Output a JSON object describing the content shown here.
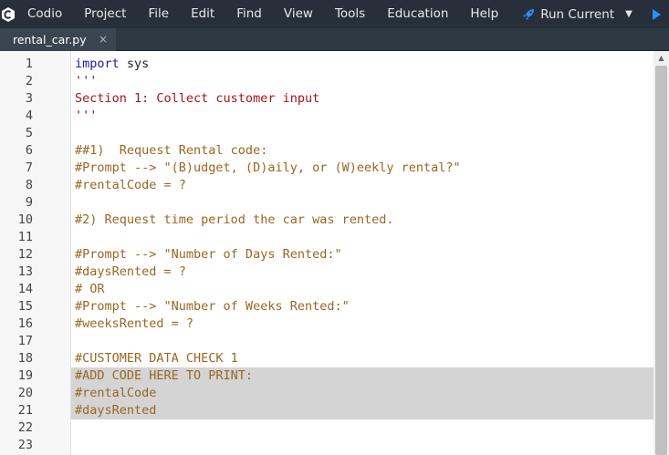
{
  "menubar": {
    "items": [
      "Codio",
      "Project",
      "File",
      "Edit",
      "Find",
      "View",
      "Tools",
      "Education",
      "Help"
    ],
    "run_label": "Run Current",
    "go_label": "Go"
  },
  "tab": {
    "filename": "rental_car.py",
    "close": "×"
  },
  "editor": {
    "lines": [
      {
        "n": "1",
        "parts": [
          {
            "t": "import",
            "c": "kw"
          },
          {
            "t": " sys",
            "c": "plain"
          }
        ]
      },
      {
        "n": "2",
        "parts": [
          {
            "t": "'''",
            "c": "str"
          }
        ]
      },
      {
        "n": "3",
        "parts": [
          {
            "t": "Section 1: Collect customer input",
            "c": "str"
          }
        ]
      },
      {
        "n": "4",
        "parts": [
          {
            "t": "'''",
            "c": "str"
          }
        ]
      },
      {
        "n": "5",
        "parts": []
      },
      {
        "n": "6",
        "parts": [
          {
            "t": "##1)  Request Rental code:",
            "c": "cm"
          }
        ]
      },
      {
        "n": "7",
        "parts": [
          {
            "t": "#Prompt --> \"(B)udget, (D)aily, or (W)eekly rental?\"",
            "c": "cm"
          }
        ]
      },
      {
        "n": "8",
        "parts": [
          {
            "t": "#rentalCode = ?",
            "c": "cm"
          }
        ]
      },
      {
        "n": "9",
        "parts": []
      },
      {
        "n": "10",
        "parts": [
          {
            "t": "#2) Request time period the car was rented.",
            "c": "cm"
          }
        ]
      },
      {
        "n": "11",
        "parts": []
      },
      {
        "n": "12",
        "parts": [
          {
            "t": "#Prompt --> \"Number of Days Rented:\"",
            "c": "cm"
          }
        ]
      },
      {
        "n": "13",
        "parts": [
          {
            "t": "#daysRented = ?",
            "c": "cm"
          }
        ]
      },
      {
        "n": "14",
        "parts": [
          {
            "t": "# OR",
            "c": "cm"
          }
        ]
      },
      {
        "n": "15",
        "parts": [
          {
            "t": "#Prompt --> \"Number of Weeks Rented:\"",
            "c": "cm"
          }
        ]
      },
      {
        "n": "16",
        "parts": [
          {
            "t": "#weeksRented = ?",
            "c": "cm"
          }
        ]
      },
      {
        "n": "17",
        "parts": []
      },
      {
        "n": "18",
        "parts": [
          {
            "t": "#CUSTOMER DATA CHECK 1",
            "c": "cm"
          }
        ]
      },
      {
        "n": "19",
        "parts": [
          {
            "t": "#ADD CODE HERE TO PRINT:",
            "c": "cm"
          }
        ]
      },
      {
        "n": "20",
        "parts": [
          {
            "t": "#rentalCode",
            "c": "cm"
          }
        ]
      },
      {
        "n": "21",
        "parts": [
          {
            "t": "#daysRented",
            "c": "cm"
          }
        ]
      },
      {
        "n": "22",
        "parts": []
      },
      {
        "n": "23",
        "parts": []
      }
    ],
    "highlighted_lines": [
      "19",
      "20",
      "21"
    ]
  },
  "colors": {
    "menubar_bg": "#27303a",
    "keyword": "#1a1aa6",
    "string": "#a31515",
    "comment": "#996622",
    "run_icon": "#2a8fff"
  },
  "icons": {
    "logo": "codio-logo-icon",
    "run": "rocket-icon",
    "dropdown": "caret-down-icon",
    "go": "play-icon",
    "close": "close-icon",
    "scroll_up": "scroll-up-arrow-icon"
  }
}
